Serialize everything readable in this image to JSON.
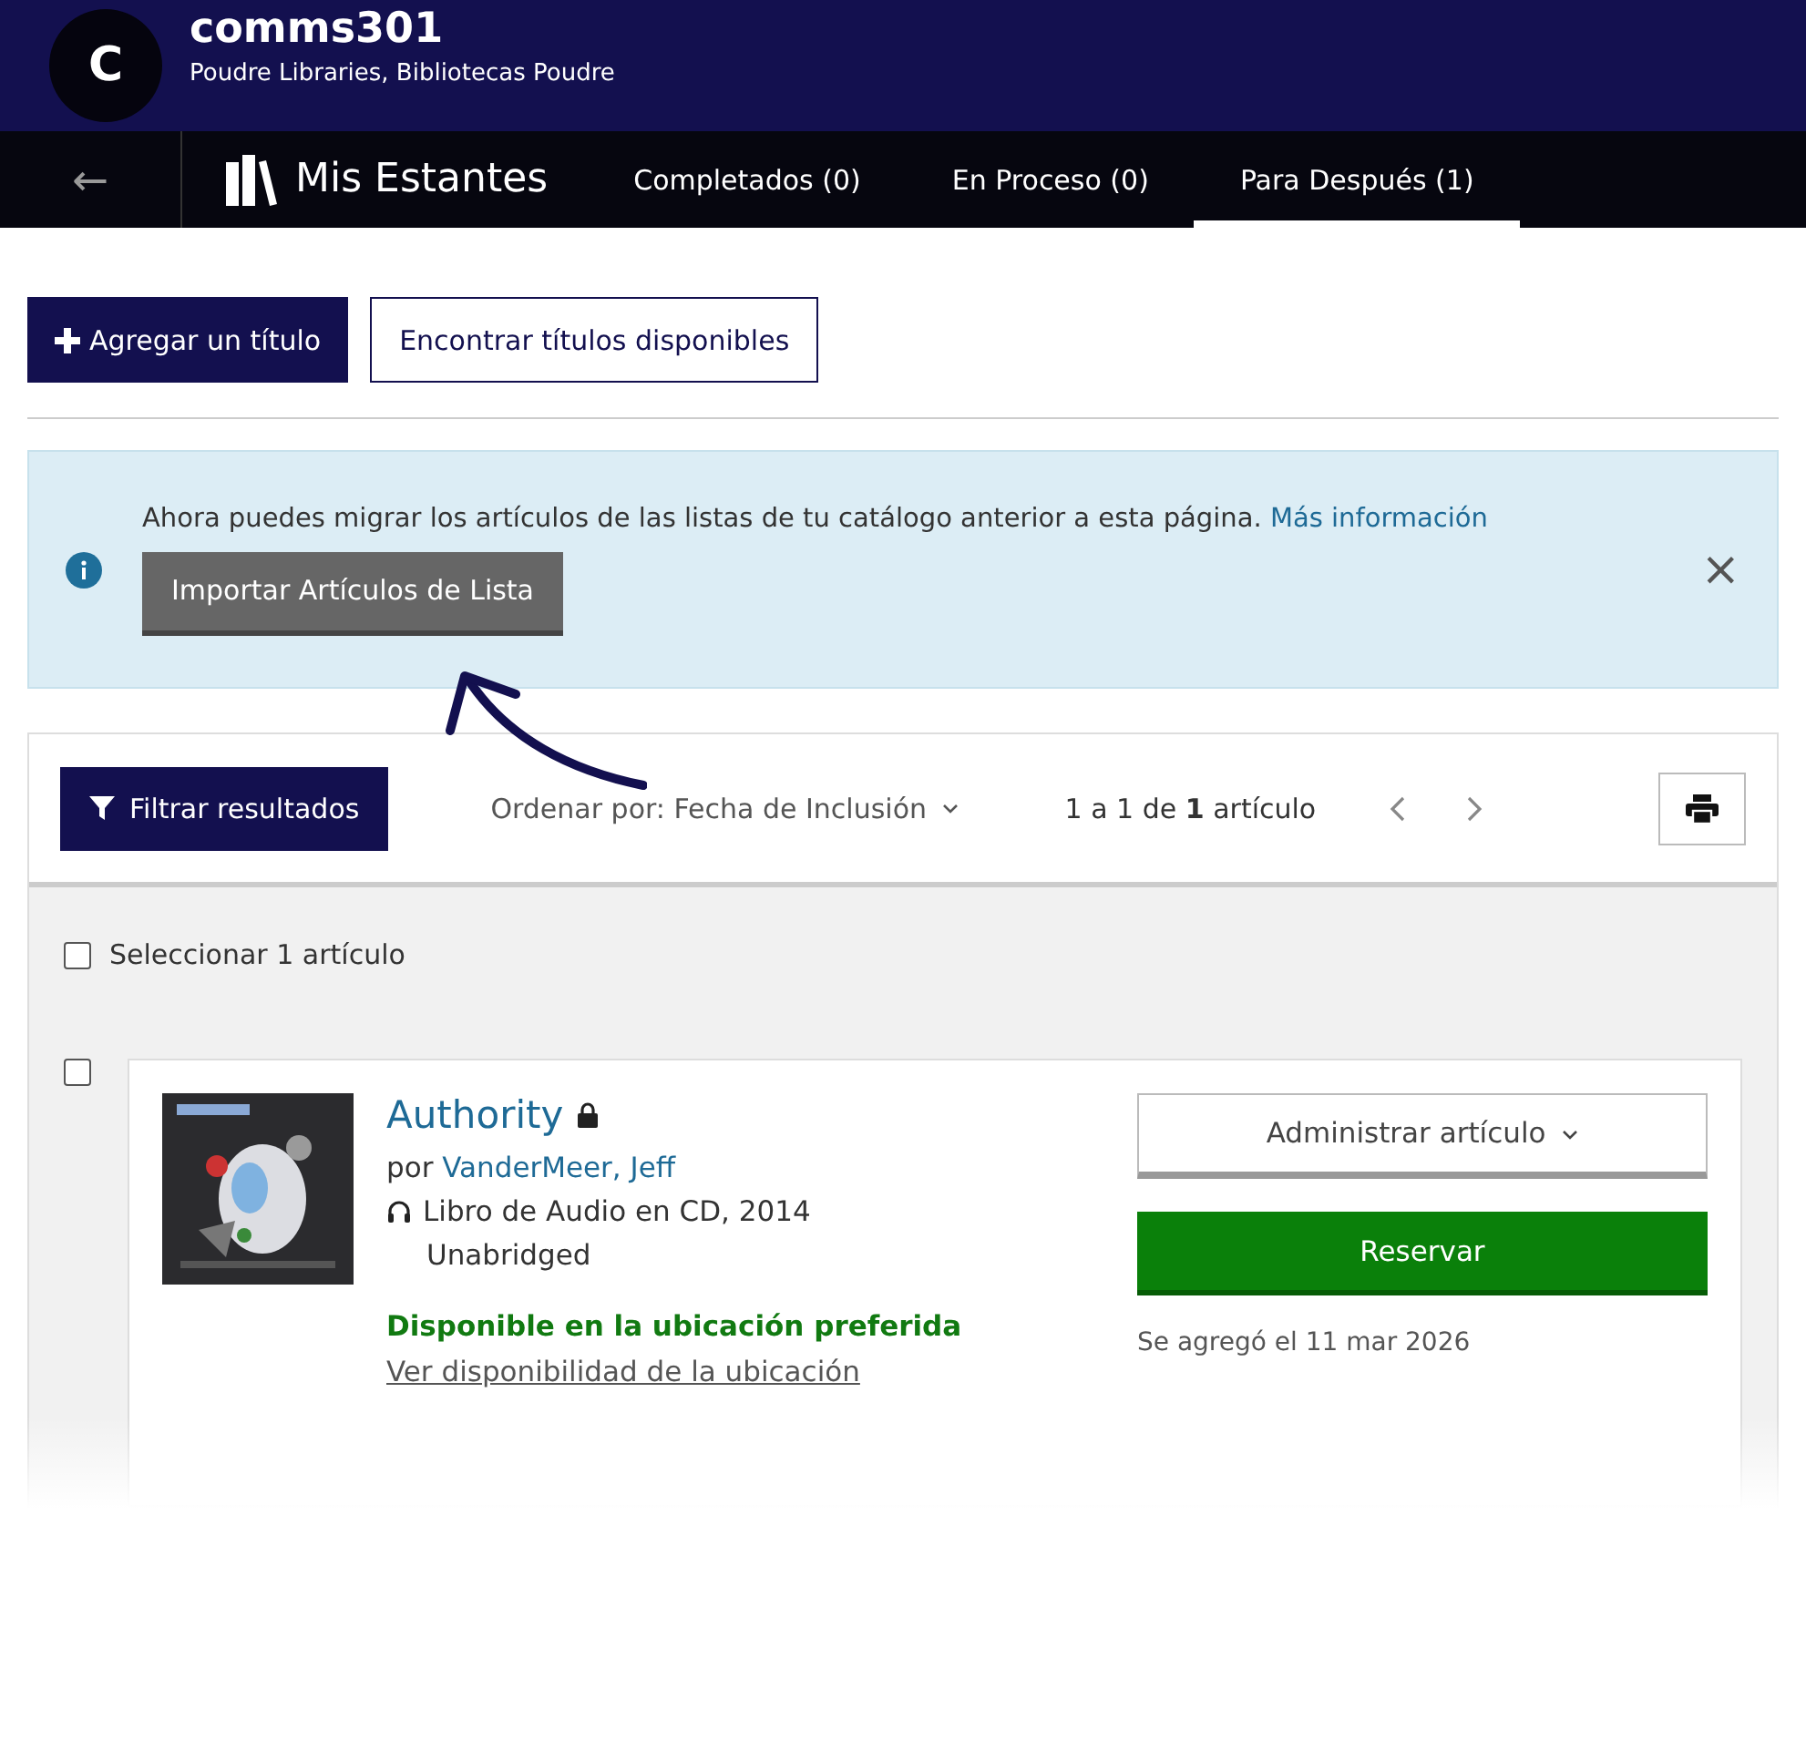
{
  "header": {
    "avatar_letter": "C",
    "username": "comms301",
    "library": "Poudre Libraries, Bibliotecas Poudre"
  },
  "nav": {
    "back": "←",
    "title": "Mis Estantes",
    "tabs": [
      {
        "label": "Completados (0)",
        "selected": false
      },
      {
        "label": "En Proceso (0)",
        "selected": false
      },
      {
        "label": "Para Después (1)",
        "selected": true
      }
    ]
  },
  "actions": [
    {
      "kind": "primary",
      "label": "Agregar un título"
    },
    {
      "kind": "outline",
      "label": "Encontrar títulos disponibles"
    }
  ],
  "notice": {
    "text": "Ahora puedes migrar los artículos de las listas de tu catálogo anterior a esta página.",
    "link": "Más información",
    "button": "Importar Artículos de Lista",
    "close": "×"
  },
  "toolbar": {
    "filter": "Filtrar resultados",
    "sort": "Ordenar por: Fecha de Inclusión",
    "count": "1 a 1 de **1** artículo"
  },
  "select_all": {
    "label": "Seleccionar 1 artículo",
    "checked": false
  },
  "items": [
    {
      "checked": false,
      "title": "Authority",
      "locked": true,
      "by": "por",
      "author": "VanderMeer, Jeff",
      "format": "Libro de Audio en CD, 2014",
      "edition": "Unabridged",
      "availability": "Disponible en la ubicación preferida",
      "availability_link": "Ver disponibilidad de la ubicación",
      "manage": "Administrar artículo",
      "hold": "Reservar",
      "added": "Se agregó el 11 mar 2026"
    }
  ]
}
